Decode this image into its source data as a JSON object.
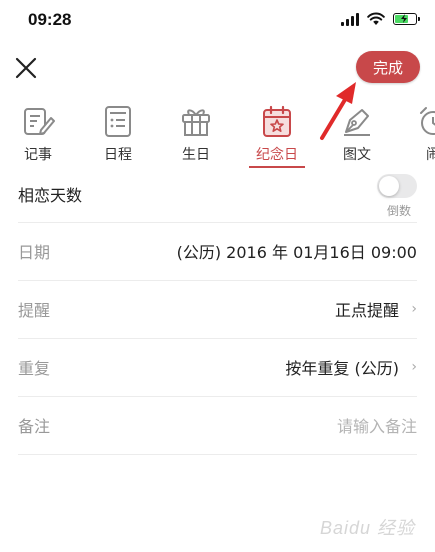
{
  "status": {
    "time": "09:28",
    "battery_level": 0.7,
    "battery_color": "#4cd964"
  },
  "topbar": {
    "done_label": "完成",
    "accent": "#c8484a"
  },
  "tabs": [
    {
      "label": "记事",
      "icon": "note-edit-icon"
    },
    {
      "label": "日程",
      "icon": "schedule-list-icon"
    },
    {
      "label": "生日",
      "icon": "gift-icon"
    },
    {
      "label": "纪念日",
      "icon": "anniversary-calendar-star-icon",
      "active": true
    },
    {
      "label": "图文",
      "icon": "pen-image-icon"
    },
    {
      "label": "闹",
      "icon": "alarm-clock-icon"
    }
  ],
  "form": {
    "name_label": "相恋天数",
    "countdown_label": "倒数",
    "countdown_on": false,
    "rows": [
      {
        "title": "日期",
        "value": "(公历) 2016 年 01月16日 09:00"
      },
      {
        "title": "提醒",
        "value": "正点提醒"
      },
      {
        "title": "重复",
        "value": "按年重复 (公历)"
      },
      {
        "title": "备注",
        "placeholder": "请输入备注"
      }
    ]
  },
  "watermark": "Baidu 经验"
}
